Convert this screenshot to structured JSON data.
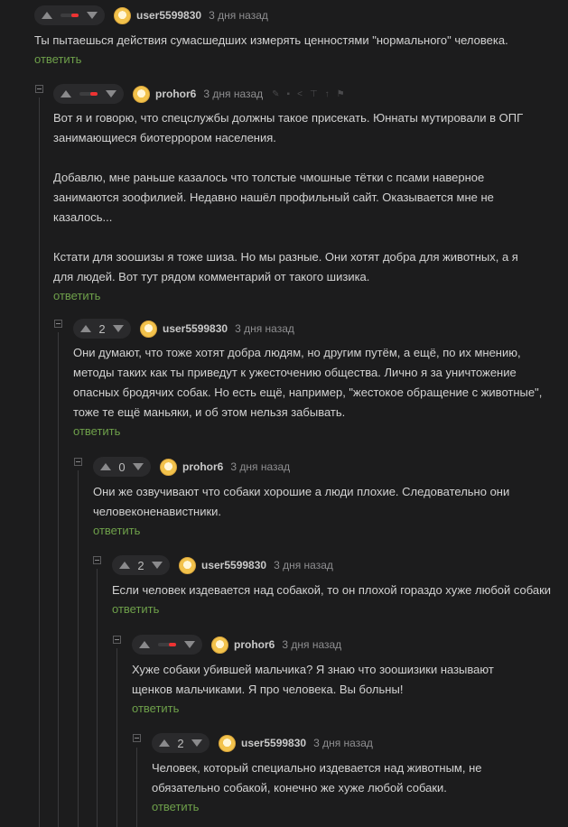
{
  "comments": [
    {
      "rating_type": "bar",
      "rating_bar_fraction": 0.4,
      "user": "user5599830",
      "time": "3 дня назад",
      "text": [
        "Ты пытаешься действия сумасшедших измерять ценностями \"нормального\" человека."
      ],
      "reply": "ответить"
    },
    {
      "rating_type": "bar",
      "rating_bar_fraction": 0.4,
      "user": "prohor6",
      "time": "3 дня назад",
      "tools": [
        "pencil-icon",
        "save-icon",
        "share-icon",
        "up-icon",
        "arrow-up-small-icon",
        "flag-icon"
      ],
      "text": [
        "Вот я и говорю, что спецслужбы должны такое присекать. Юннаты мутировали в ОПГ занимающиеся биотеррором населения.",
        "Добавлю, мне раньше казалось что толстые чмошные тётки с псами наверное занимаются зоофилией. Недавно нашёл профильный сайт. Оказывается мне не казалось...",
        "Кстати для зоошизы я тоже шиза. Но мы разные. Они хотят добра для животных, а я для людей. Вот тут рядом комментарий от такого шизика."
      ],
      "reply": "ответить"
    },
    {
      "rating_type": "number",
      "rating": "2",
      "user": "user5599830",
      "time": "3 дня назад",
      "text": [
        "Они думают, что тоже хотят добра людям, но другим путём, а ещё, по их мнению, методы таких как ты приведут к ужесточению общества. Лично я за уничтожение опасных бродячих собак. Но есть ещё, например, \"жестокое обращение с животные\", тоже те ещё маньяки, и об этом нельзя забывать."
      ],
      "reply": "ответить"
    },
    {
      "rating_type": "number",
      "rating": "0",
      "user": "prohor6",
      "time": "3 дня назад",
      "text": [
        "Они же озвучивают что собаки хорошие а люди плохие. Следовательно они человеконенавистники."
      ],
      "reply": "ответить"
    },
    {
      "rating_type": "number",
      "rating": "2",
      "user": "user5599830",
      "time": "3 дня назад",
      "text": [
        "Если человек издевается над собакой, то он плохой гораздо хуже любой собаки"
      ],
      "reply": "ответить"
    },
    {
      "rating_type": "bar",
      "rating_bar_fraction": 0.4,
      "user": "prohor6",
      "time": "3 дня назад",
      "text": [
        "Хуже собаки убившей мальчика? Я знаю что зоошизики называют щенков мальчиками. Я про человека. Вы больны!"
      ],
      "reply": "ответить"
    },
    {
      "rating_type": "number",
      "rating": "2",
      "user": "user5599830",
      "time": "3 дня назад",
      "text": [
        "Человек, который специально издевается над животным, не обязательно собакой, конечно же хуже любой собаки."
      ],
      "reply": "ответить"
    }
  ]
}
